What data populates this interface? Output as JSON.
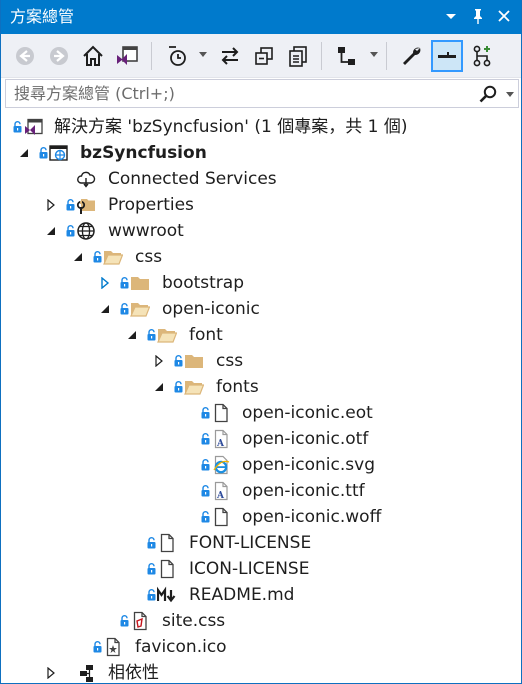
{
  "window": {
    "title": "方案總管"
  },
  "search": {
    "placeholder": "搜尋方案總管 (Ctrl+;)"
  },
  "colors": {
    "title_bar": "#007acc",
    "toolbar": "#eef0f5",
    "folder": "#dcb67a",
    "lock": "#1e88e5",
    "vs_purple": "#68217a"
  },
  "tree": {
    "solution": "解決方案 'bzSyncfusion' (1 個專案，共 1 個)",
    "project": "bzSyncfusion",
    "connected_services": "Connected Services",
    "properties": "Properties",
    "wwwroot": "wwwroot",
    "css": "css",
    "bootstrap": "bootstrap",
    "open_iconic": "open-iconic",
    "font": "font",
    "font_css": "css",
    "fonts": "fonts",
    "eot": "open-iconic.eot",
    "otf": "open-iconic.otf",
    "svg": "open-iconic.svg",
    "ttf": "open-iconic.ttf",
    "woff": "open-iconic.woff",
    "font_license": "FONT-LICENSE",
    "icon_license": "ICON-LICENSE",
    "readme": "README.md",
    "site_css": "site.css",
    "favicon": "favicon.ico",
    "dependencies": "相依性"
  }
}
